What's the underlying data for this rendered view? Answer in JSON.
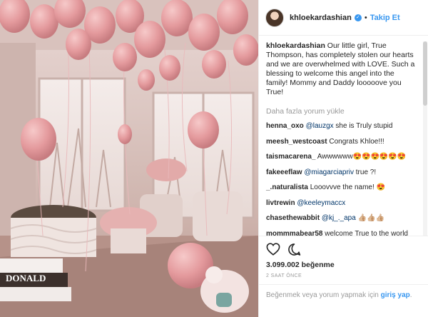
{
  "header": {
    "username": "khloekardashian",
    "verified_icon": "verified-badge-icon",
    "separator": "•",
    "follow_label": "Takip Et"
  },
  "caption": {
    "username": "khloekardashian",
    "text": "Our little girl, True Thompson, has completely stolen our hearts and we are overwhelmed with LOVE. Such a blessing to welcome this angel into the family! Mommy and Daddy looooove you True!"
  },
  "load_more_label": "Daha fazla yorum yükle",
  "comments": [
    {
      "username": "henna_oxo",
      "mention": "@lauzgx",
      "text": " she is Truly stupid"
    },
    {
      "username": "meesh_westcoast",
      "mention": "",
      "text": "Congrats Khloe!!!"
    },
    {
      "username": "taismacarena_",
      "mention": "",
      "text": "Awwwwww😍😍😍😍😍😍"
    },
    {
      "username": "fakeeeflaw",
      "mention": "@miagarciapriv",
      "text": " true ?!"
    },
    {
      "username": "_.naturalista",
      "mention": "",
      "text": "Looovvve the name! 😍"
    },
    {
      "username": "livtrewin",
      "mention": "@keeleymaccx",
      "text": ""
    },
    {
      "username": "chasethewabbit",
      "mention": "@kj_._apa",
      "text": " 👍🏼👍🏼👍🏼"
    },
    {
      "username": "mommmabear58",
      "mention": "",
      "text": "welcome True to the world❤️❤️❤️"
    }
  ],
  "actions": {
    "like_icon": "heart-icon",
    "comment_icon": "comment-icon",
    "likes_count": "3.099.002",
    "likes_label": "beğenme",
    "time_ago": "2 SAAT ÖNCE"
  },
  "login": {
    "prompt": "Beğenmek veya yorum yapmak için ",
    "link_label": "giriş yap",
    "suffix": "."
  },
  "colors": {
    "link_blue": "#3897f0",
    "mention_blue": "#003569",
    "balloon_pink": "#e9a3a6"
  }
}
